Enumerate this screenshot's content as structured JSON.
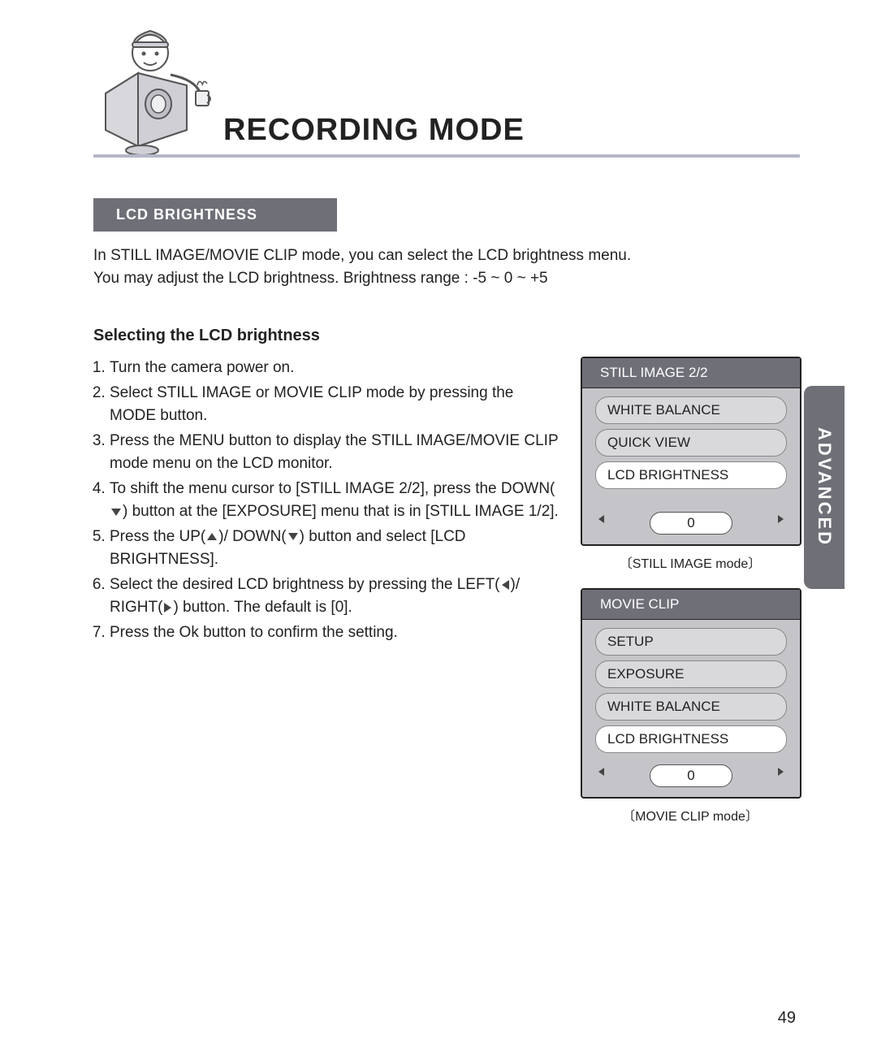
{
  "header": {
    "title": "RECORDING MODE"
  },
  "section_label": "LCD BRIGHTNESS",
  "intro_line1": "In STILL IMAGE/MOVIE CLIP mode, you can select the LCD brightness menu.",
  "intro_line2": "You may adjust the LCD brightness. Brightness range : -5 ~ 0 ~ +5",
  "subheading": "Selecting the LCD brightness",
  "steps": {
    "s1": "Turn the camera power on.",
    "s2": "Select STILL IMAGE or MOVIE CLIP mode by pressing the MODE button.",
    "s3": "Press the MENU button to display the STILL IMAGE/MOVIE CLIP mode menu on the LCD monitor.",
    "s4a": "To shift the menu cursor to [STILL IMAGE 2/2], press the DOWN(",
    "s4b": ") button at the [EXPOSURE] menu that is in [STILL IMAGE 1/2].",
    "s5a": "Press the UP(",
    "s5b": ")/ DOWN(",
    "s5c": ") button and select [LCD BRIGHTNESS].",
    "s6a": "Select the desired LCD brightness by pressing the LEFT(",
    "s6b": ")/ RIGHT(",
    "s6c": ") button. The default is [0].",
    "s7": "Press the Ok button to confirm the setting."
  },
  "screen1": {
    "title": "STILL IMAGE 2/2",
    "items": [
      "WHITE BALANCE",
      "QUICK VIEW",
      "LCD BRIGHTNESS"
    ],
    "selected_index": 2,
    "value": "0",
    "caption": "STILL IMAGE mode"
  },
  "screen2": {
    "title": "MOVIE CLIP",
    "items": [
      "SETUP",
      "EXPOSURE",
      "WHITE BALANCE",
      "LCD BRIGHTNESS"
    ],
    "selected_index": 3,
    "value": "0",
    "caption": "MOVIE CLIP mode"
  },
  "side_tab": "ADVANCED",
  "page_number": "49"
}
